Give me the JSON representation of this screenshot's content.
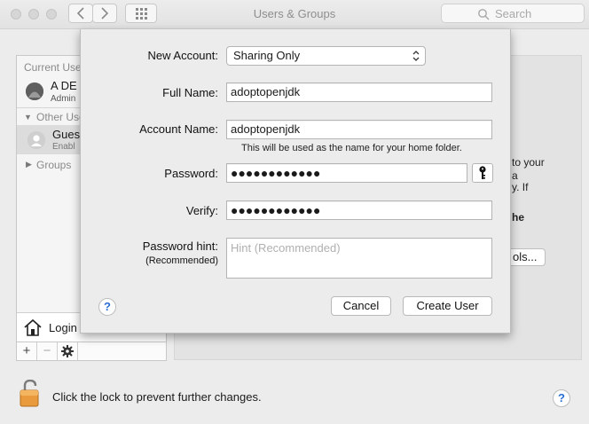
{
  "window": {
    "title": "Users & Groups"
  },
  "search": {
    "placeholder": "Search"
  },
  "sidebar": {
    "current_users_label": "Current Use",
    "admin_user": {
      "name": "A DE",
      "role": "Admin"
    },
    "other_users_label": "Other Use",
    "guest_user": {
      "name": "Gues",
      "status": "Enabl"
    },
    "groups_label": "Groups",
    "login_label": "Login"
  },
  "right_pane": {
    "snippet_1": "to your",
    "snippet_2": "a",
    "snippet_3": "y. If",
    "snippet_4": "he",
    "options_button": "ols..."
  },
  "bottom": {
    "lock_text": "Click the lock to prevent further changes."
  },
  "sheet": {
    "new_account_label": "New Account:",
    "new_account_value": "Sharing Only",
    "full_name_label": "Full Name:",
    "full_name_value": "adoptopenjdk",
    "account_name_label": "Account Name:",
    "account_name_value": "adoptopenjdk",
    "account_name_hint": "This will be used as the name for your home folder.",
    "password_label": "Password:",
    "password_value": "●●●●●●●●●●●●",
    "verify_label": "Verify:",
    "verify_value": "●●●●●●●●●●●●",
    "password_hint_label": "Password hint:",
    "password_hint_sublabel": "(Recommended)",
    "password_hint_placeholder": "Hint (Recommended)",
    "cancel_button": "Cancel",
    "create_button": "Create User",
    "help_glyph": "?"
  },
  "help_glyph": "?",
  "colors": {
    "accent": "#2a6fd6",
    "window_bg": "#ececec"
  }
}
